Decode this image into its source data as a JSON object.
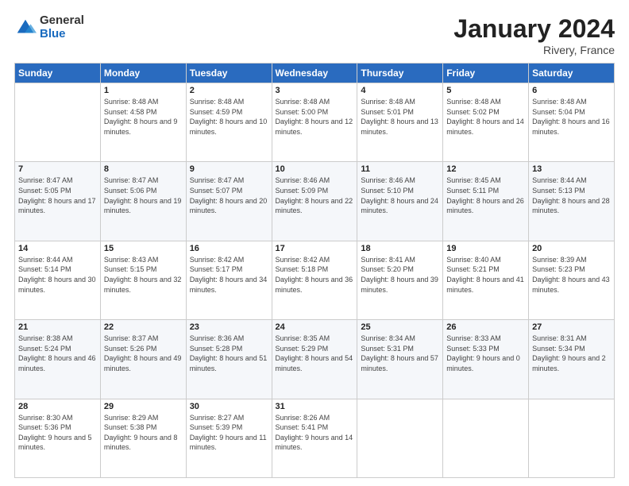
{
  "logo": {
    "general": "General",
    "blue": "Blue"
  },
  "title": "January 2024",
  "location": "Rivery, France",
  "days_header": [
    "Sunday",
    "Monday",
    "Tuesday",
    "Wednesday",
    "Thursday",
    "Friday",
    "Saturday"
  ],
  "weeks": [
    [
      {
        "num": "",
        "sunrise": "",
        "sunset": "",
        "daylight": ""
      },
      {
        "num": "1",
        "sunrise": "Sunrise: 8:48 AM",
        "sunset": "Sunset: 4:58 PM",
        "daylight": "Daylight: 8 hours and 9 minutes."
      },
      {
        "num": "2",
        "sunrise": "Sunrise: 8:48 AM",
        "sunset": "Sunset: 4:59 PM",
        "daylight": "Daylight: 8 hours and 10 minutes."
      },
      {
        "num": "3",
        "sunrise": "Sunrise: 8:48 AM",
        "sunset": "Sunset: 5:00 PM",
        "daylight": "Daylight: 8 hours and 12 minutes."
      },
      {
        "num": "4",
        "sunrise": "Sunrise: 8:48 AM",
        "sunset": "Sunset: 5:01 PM",
        "daylight": "Daylight: 8 hours and 13 minutes."
      },
      {
        "num": "5",
        "sunrise": "Sunrise: 8:48 AM",
        "sunset": "Sunset: 5:02 PM",
        "daylight": "Daylight: 8 hours and 14 minutes."
      },
      {
        "num": "6",
        "sunrise": "Sunrise: 8:48 AM",
        "sunset": "Sunset: 5:04 PM",
        "daylight": "Daylight: 8 hours and 16 minutes."
      }
    ],
    [
      {
        "num": "7",
        "sunrise": "Sunrise: 8:47 AM",
        "sunset": "Sunset: 5:05 PM",
        "daylight": "Daylight: 8 hours and 17 minutes."
      },
      {
        "num": "8",
        "sunrise": "Sunrise: 8:47 AM",
        "sunset": "Sunset: 5:06 PM",
        "daylight": "Daylight: 8 hours and 19 minutes."
      },
      {
        "num": "9",
        "sunrise": "Sunrise: 8:47 AM",
        "sunset": "Sunset: 5:07 PM",
        "daylight": "Daylight: 8 hours and 20 minutes."
      },
      {
        "num": "10",
        "sunrise": "Sunrise: 8:46 AM",
        "sunset": "Sunset: 5:09 PM",
        "daylight": "Daylight: 8 hours and 22 minutes."
      },
      {
        "num": "11",
        "sunrise": "Sunrise: 8:46 AM",
        "sunset": "Sunset: 5:10 PM",
        "daylight": "Daylight: 8 hours and 24 minutes."
      },
      {
        "num": "12",
        "sunrise": "Sunrise: 8:45 AM",
        "sunset": "Sunset: 5:11 PM",
        "daylight": "Daylight: 8 hours and 26 minutes."
      },
      {
        "num": "13",
        "sunrise": "Sunrise: 8:44 AM",
        "sunset": "Sunset: 5:13 PM",
        "daylight": "Daylight: 8 hours and 28 minutes."
      }
    ],
    [
      {
        "num": "14",
        "sunrise": "Sunrise: 8:44 AM",
        "sunset": "Sunset: 5:14 PM",
        "daylight": "Daylight: 8 hours and 30 minutes."
      },
      {
        "num": "15",
        "sunrise": "Sunrise: 8:43 AM",
        "sunset": "Sunset: 5:15 PM",
        "daylight": "Daylight: 8 hours and 32 minutes."
      },
      {
        "num": "16",
        "sunrise": "Sunrise: 8:42 AM",
        "sunset": "Sunset: 5:17 PM",
        "daylight": "Daylight: 8 hours and 34 minutes."
      },
      {
        "num": "17",
        "sunrise": "Sunrise: 8:42 AM",
        "sunset": "Sunset: 5:18 PM",
        "daylight": "Daylight: 8 hours and 36 minutes."
      },
      {
        "num": "18",
        "sunrise": "Sunrise: 8:41 AM",
        "sunset": "Sunset: 5:20 PM",
        "daylight": "Daylight: 8 hours and 39 minutes."
      },
      {
        "num": "19",
        "sunrise": "Sunrise: 8:40 AM",
        "sunset": "Sunset: 5:21 PM",
        "daylight": "Daylight: 8 hours and 41 minutes."
      },
      {
        "num": "20",
        "sunrise": "Sunrise: 8:39 AM",
        "sunset": "Sunset: 5:23 PM",
        "daylight": "Daylight: 8 hours and 43 minutes."
      }
    ],
    [
      {
        "num": "21",
        "sunrise": "Sunrise: 8:38 AM",
        "sunset": "Sunset: 5:24 PM",
        "daylight": "Daylight: 8 hours and 46 minutes."
      },
      {
        "num": "22",
        "sunrise": "Sunrise: 8:37 AM",
        "sunset": "Sunset: 5:26 PM",
        "daylight": "Daylight: 8 hours and 49 minutes."
      },
      {
        "num": "23",
        "sunrise": "Sunrise: 8:36 AM",
        "sunset": "Sunset: 5:28 PM",
        "daylight": "Daylight: 8 hours and 51 minutes."
      },
      {
        "num": "24",
        "sunrise": "Sunrise: 8:35 AM",
        "sunset": "Sunset: 5:29 PM",
        "daylight": "Daylight: 8 hours and 54 minutes."
      },
      {
        "num": "25",
        "sunrise": "Sunrise: 8:34 AM",
        "sunset": "Sunset: 5:31 PM",
        "daylight": "Daylight: 8 hours and 57 minutes."
      },
      {
        "num": "26",
        "sunrise": "Sunrise: 8:33 AM",
        "sunset": "Sunset: 5:33 PM",
        "daylight": "Daylight: 9 hours and 0 minutes."
      },
      {
        "num": "27",
        "sunrise": "Sunrise: 8:31 AM",
        "sunset": "Sunset: 5:34 PM",
        "daylight": "Daylight: 9 hours and 2 minutes."
      }
    ],
    [
      {
        "num": "28",
        "sunrise": "Sunrise: 8:30 AM",
        "sunset": "Sunset: 5:36 PM",
        "daylight": "Daylight: 9 hours and 5 minutes."
      },
      {
        "num": "29",
        "sunrise": "Sunrise: 8:29 AM",
        "sunset": "Sunset: 5:38 PM",
        "daylight": "Daylight: 9 hours and 8 minutes."
      },
      {
        "num": "30",
        "sunrise": "Sunrise: 8:27 AM",
        "sunset": "Sunset: 5:39 PM",
        "daylight": "Daylight: 9 hours and 11 minutes."
      },
      {
        "num": "31",
        "sunrise": "Sunrise: 8:26 AM",
        "sunset": "Sunset: 5:41 PM",
        "daylight": "Daylight: 9 hours and 14 minutes."
      },
      {
        "num": "",
        "sunrise": "",
        "sunset": "",
        "daylight": ""
      },
      {
        "num": "",
        "sunrise": "",
        "sunset": "",
        "daylight": ""
      },
      {
        "num": "",
        "sunrise": "",
        "sunset": "",
        "daylight": ""
      }
    ]
  ]
}
